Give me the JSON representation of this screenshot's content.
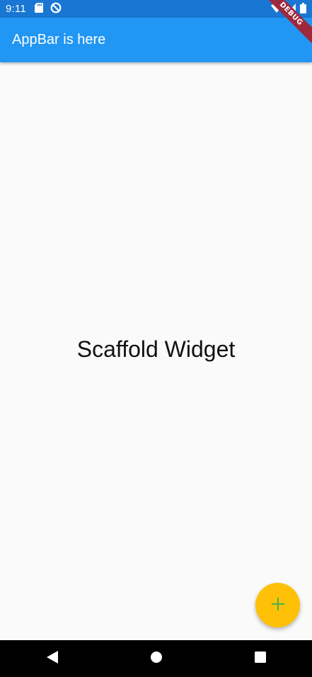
{
  "status_bar": {
    "time": "9:11",
    "left_icons": [
      "sd-card-icon",
      "data-saver-icon"
    ],
    "right_icons": [
      "wifi-icon",
      "signal-icon",
      "battery-icon"
    ]
  },
  "debug_banner": {
    "label": "DEBUG",
    "color": "#a0283d"
  },
  "app_bar": {
    "title": "AppBar is here",
    "color": "#2196f3"
  },
  "body": {
    "text": "Scaffold Widget"
  },
  "fab": {
    "icon": "add-icon",
    "color": "#ffc107",
    "icon_color": "#4caf50"
  },
  "nav_bar": {
    "buttons": [
      "back-icon",
      "home-icon",
      "recents-icon"
    ]
  }
}
